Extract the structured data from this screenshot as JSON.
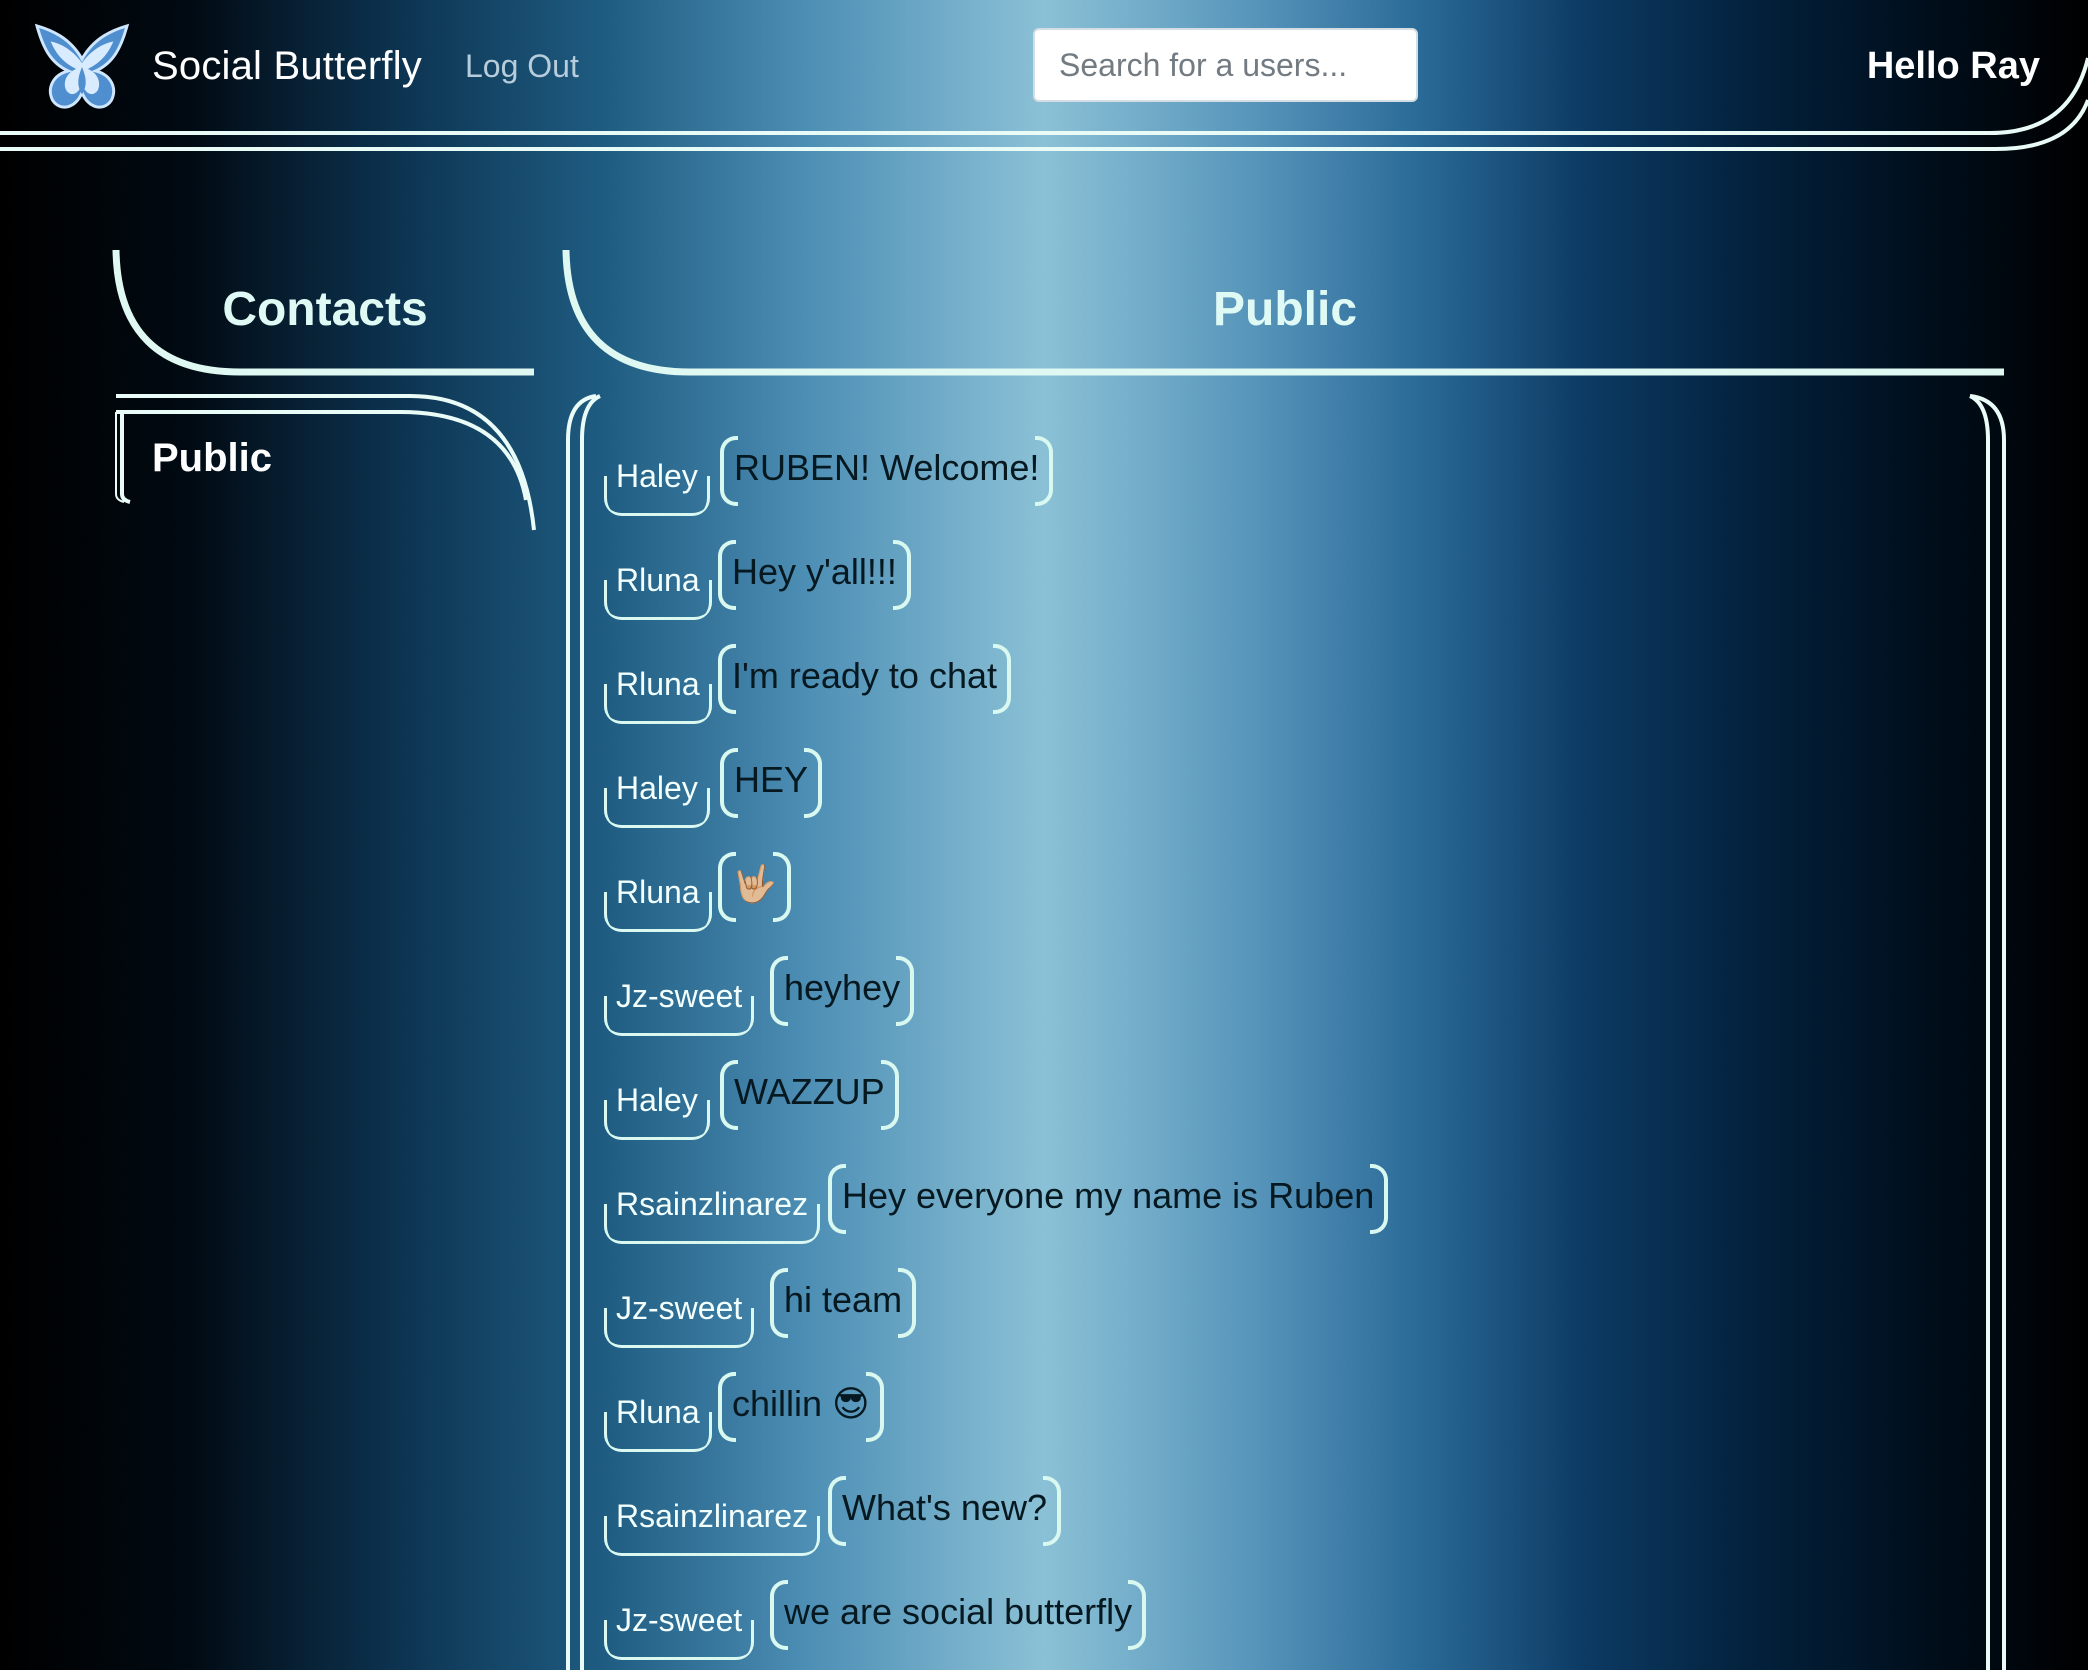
{
  "navbar": {
    "brand": "Social Butterfly",
    "logout_label": "Log Out",
    "search_placeholder": "Search for a users...",
    "greeting": "Hello Ray"
  },
  "contacts": {
    "title": "Contacts",
    "items": [
      {
        "label": "Public"
      }
    ]
  },
  "chat": {
    "title": "Public",
    "messages": [
      {
        "user": "Haley",
        "text": "RUBEN! Welcome!"
      },
      {
        "user": "Rluna",
        "text": "Hey y'all!!!"
      },
      {
        "user": "Rluna",
        "text": "I'm ready to chat"
      },
      {
        "user": "Haley",
        "text": "HEY"
      },
      {
        "user": "Rluna",
        "text": "🤟🏼"
      },
      {
        "user": "Jz-sweet",
        "text": "heyhey"
      },
      {
        "user": "Haley",
        "text": "WAZZUP"
      },
      {
        "user": "Rsainzlinarez",
        "text": "Hey everyone my name is Ruben"
      },
      {
        "user": "Jz-sweet",
        "text": "hi team"
      },
      {
        "user": "Rluna",
        "text": "chillin 😎"
      },
      {
        "user": "Rsainzlinarez",
        "text": "What's new?"
      },
      {
        "user": "Jz-sweet",
        "text": "we are social butterfly"
      }
    ]
  },
  "colors": {
    "accent_line": "#d8f8f0",
    "title_text": "#dffaf5",
    "logo_blue": "#4f8fd0"
  }
}
